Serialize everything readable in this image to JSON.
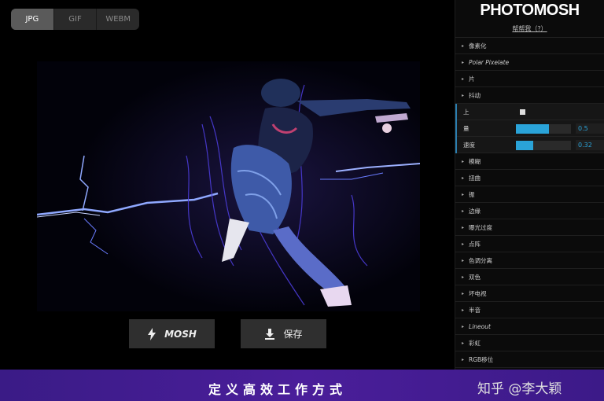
{
  "format_tabs": [
    {
      "label": "JPG",
      "active": true
    },
    {
      "label": "GIF",
      "active": false
    },
    {
      "label": "WEBM",
      "active": false
    }
  ],
  "actions": {
    "mosh_label": "MOSH",
    "save_label": "保存",
    "mosh_icon": "lightning-icon",
    "save_icon": "download-icon"
  },
  "sidebar": {
    "logo": "PHOTOMOSH",
    "help_label": "帮帮我（?）",
    "items_before": [
      {
        "label": "像素化"
      },
      {
        "label": "Polar Pixelate",
        "italic": true
      },
      {
        "label": "片"
      },
      {
        "label": "抖动"
      }
    ],
    "submenu": {
      "toggle_label": "上",
      "sliders": [
        {
          "label": "量",
          "value": "0.5",
          "fraction": 0.6
        },
        {
          "label": "速度",
          "value": "0.32",
          "fraction": 0.32
        }
      ]
    },
    "items_after": [
      {
        "label": "模糊"
      },
      {
        "label": "扭曲"
      },
      {
        "label": "振"
      },
      {
        "label": "边缘"
      },
      {
        "label": "曝光过度"
      },
      {
        "label": "点阵"
      },
      {
        "label": "色调分离"
      },
      {
        "label": "双色"
      },
      {
        "label": "坏电视"
      },
      {
        "label": "半音"
      },
      {
        "label": "Lineout",
        "italic": true
      },
      {
        "label": "彩虹"
      },
      {
        "label": "RGB移位"
      }
    ]
  },
  "banner": {
    "text": "定义高效工作方式",
    "watermark": "知乎 @李大颖"
  },
  "colors": {
    "accent": "#2aa3d8",
    "banner": "#3f1c8e",
    "glitch": "#6a5cff"
  }
}
